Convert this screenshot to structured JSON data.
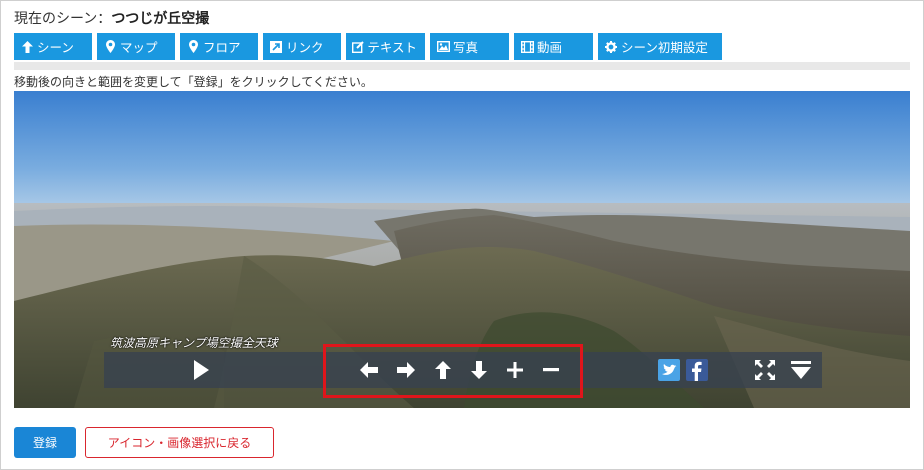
{
  "header": {
    "prefix": "現在のシーン：",
    "scene_name": "つつじが丘空撮"
  },
  "tabs": [
    {
      "label": "シーン",
      "icon": "arrow-up-icon"
    },
    {
      "label": "マップ",
      "icon": "map-marker-icon"
    },
    {
      "label": "フロア",
      "icon": "map-marker-icon"
    },
    {
      "label": "リンク",
      "icon": "external-link-icon"
    },
    {
      "label": "テキスト",
      "icon": "edit-icon"
    },
    {
      "label": "写真",
      "icon": "image-icon"
    },
    {
      "label": "動画",
      "icon": "film-icon"
    },
    {
      "label": "シーン初期設定",
      "icon": "gear-icon"
    }
  ],
  "instruction": "移動後の向きと範囲を変更して「登録」をクリックしてください。",
  "viewer": {
    "caption": "筑波高原キャンプ場空撮全天球",
    "controls": [
      "play-icon",
      "arrow-left-icon",
      "arrow-right-icon",
      "arrow-up-icon",
      "arrow-down-icon",
      "zoom-in-icon",
      "zoom-out-icon",
      "twitter-icon",
      "facebook-icon",
      "fullscreen-icon",
      "menu-toggle-icon"
    ]
  },
  "buttons": {
    "register": "登録",
    "back": "アイコン・画像選択に戻る"
  },
  "colors": {
    "tab_bg": "#1a98e0",
    "highlight": "#e0151b",
    "register_bg": "#1a86d6",
    "back_border": "#d9262e"
  }
}
